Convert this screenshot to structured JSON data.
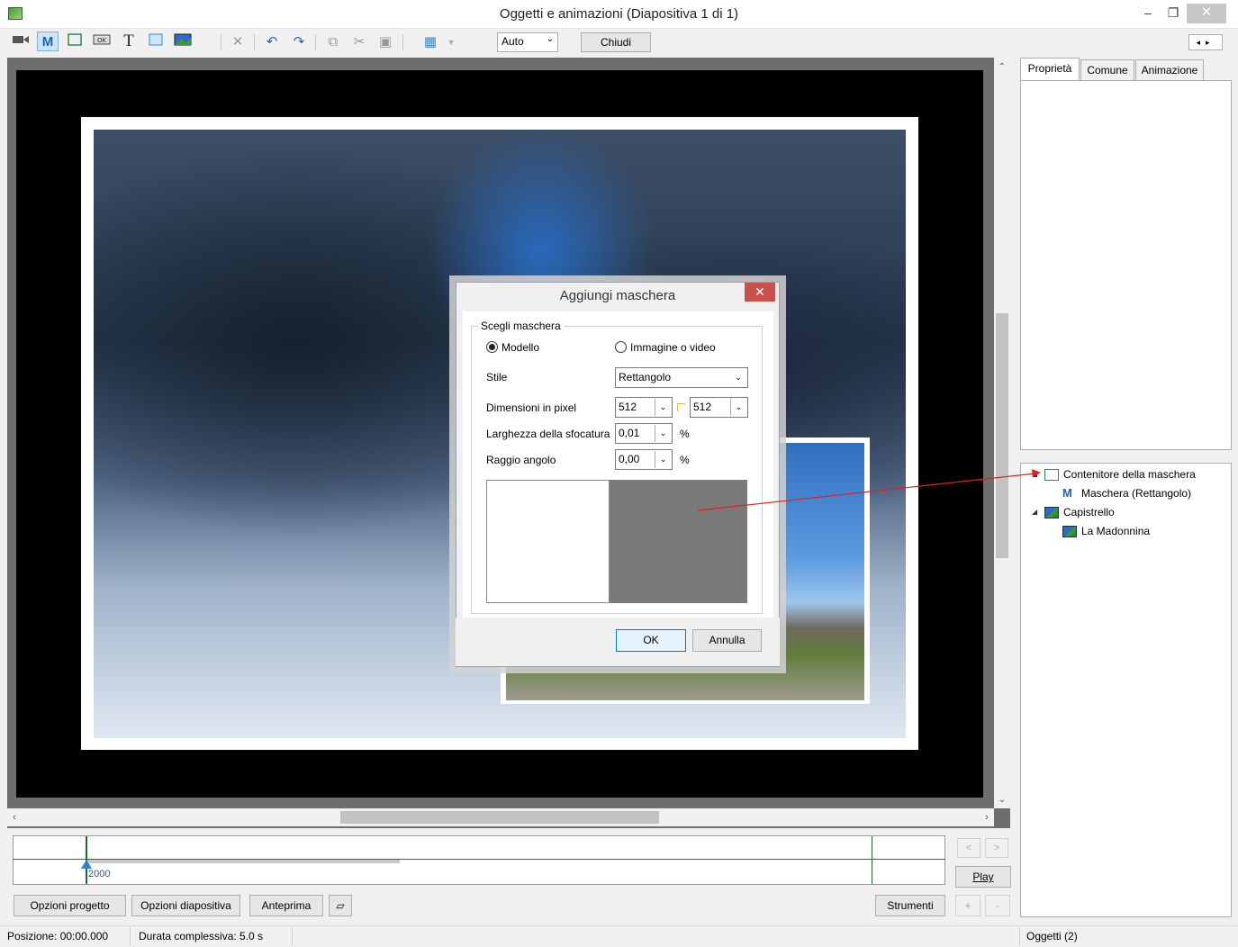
{
  "window": {
    "title": "Oggetti e animazioni  (Diapositiva 1 di 1)",
    "min_glyph": "–",
    "restore_glyph": "❐",
    "close_glyph": "✕"
  },
  "toolbar": {
    "zoom_value": "Auto",
    "chiudi_label": "Chiudi",
    "text_tool_glyph": "T",
    "mask_tool_glyph": "M"
  },
  "right_panel": {
    "tabs": [
      {
        "label": "Proprietà",
        "active": true
      },
      {
        "label": "Comune",
        "active": false
      },
      {
        "label": "Animazione",
        "active": false
      }
    ],
    "tree": [
      {
        "label": "Contenitore della maschera",
        "icon": "mask-container-icon",
        "expanded": true,
        "level": 0
      },
      {
        "label": "Maschera (Rettangolo)",
        "icon": "mask-icon",
        "expanded": false,
        "level": 1
      },
      {
        "label": "Capistrello",
        "icon": "image-icon",
        "expanded": true,
        "level": 0
      },
      {
        "label": "La Madonnina",
        "icon": "image-icon",
        "expanded": false,
        "level": 1
      }
    ]
  },
  "timeline": {
    "marker_label": "2000",
    "play_label": "Play",
    "prev_glyph": "<",
    "next_glyph": ">"
  },
  "bottom": {
    "opzioni_progetto": "Opzioni progetto",
    "opzioni_diapositiva": "Opzioni diapositiva",
    "anteprima": "Anteprima",
    "strumenti": "Strumenti",
    "plus": "+",
    "minus": "-"
  },
  "status": {
    "posizione": "Posizione:  00:00.000",
    "durata": "Durata complessiva:  5.0 s",
    "oggetti": "Oggetti (2)"
  },
  "dialog": {
    "title": "Aggiungi maschera",
    "close_glyph": "✕",
    "group_title": "Scegli maschera",
    "radio_modello": "Modello",
    "radio_immagine": "Immagine o video",
    "selected_radio": "Modello",
    "stile_label": "Stile",
    "stile_value": "Rettangolo",
    "dimensioni_label": "Dimensioni in pixel",
    "dim_width": "512",
    "dim_height": "512",
    "sfocatura_label": "Larghezza della sfocatura",
    "sfocatura_value": "0,01",
    "raggio_label": "Raggio angolo",
    "raggio_value": "0,00",
    "percent": "%",
    "ok_label": "OK",
    "annulla_label": "Annulla"
  },
  "colors": {
    "accent": "#0078d7",
    "close_red": "#c9504b",
    "annotation_arrow": "#e02020"
  }
}
